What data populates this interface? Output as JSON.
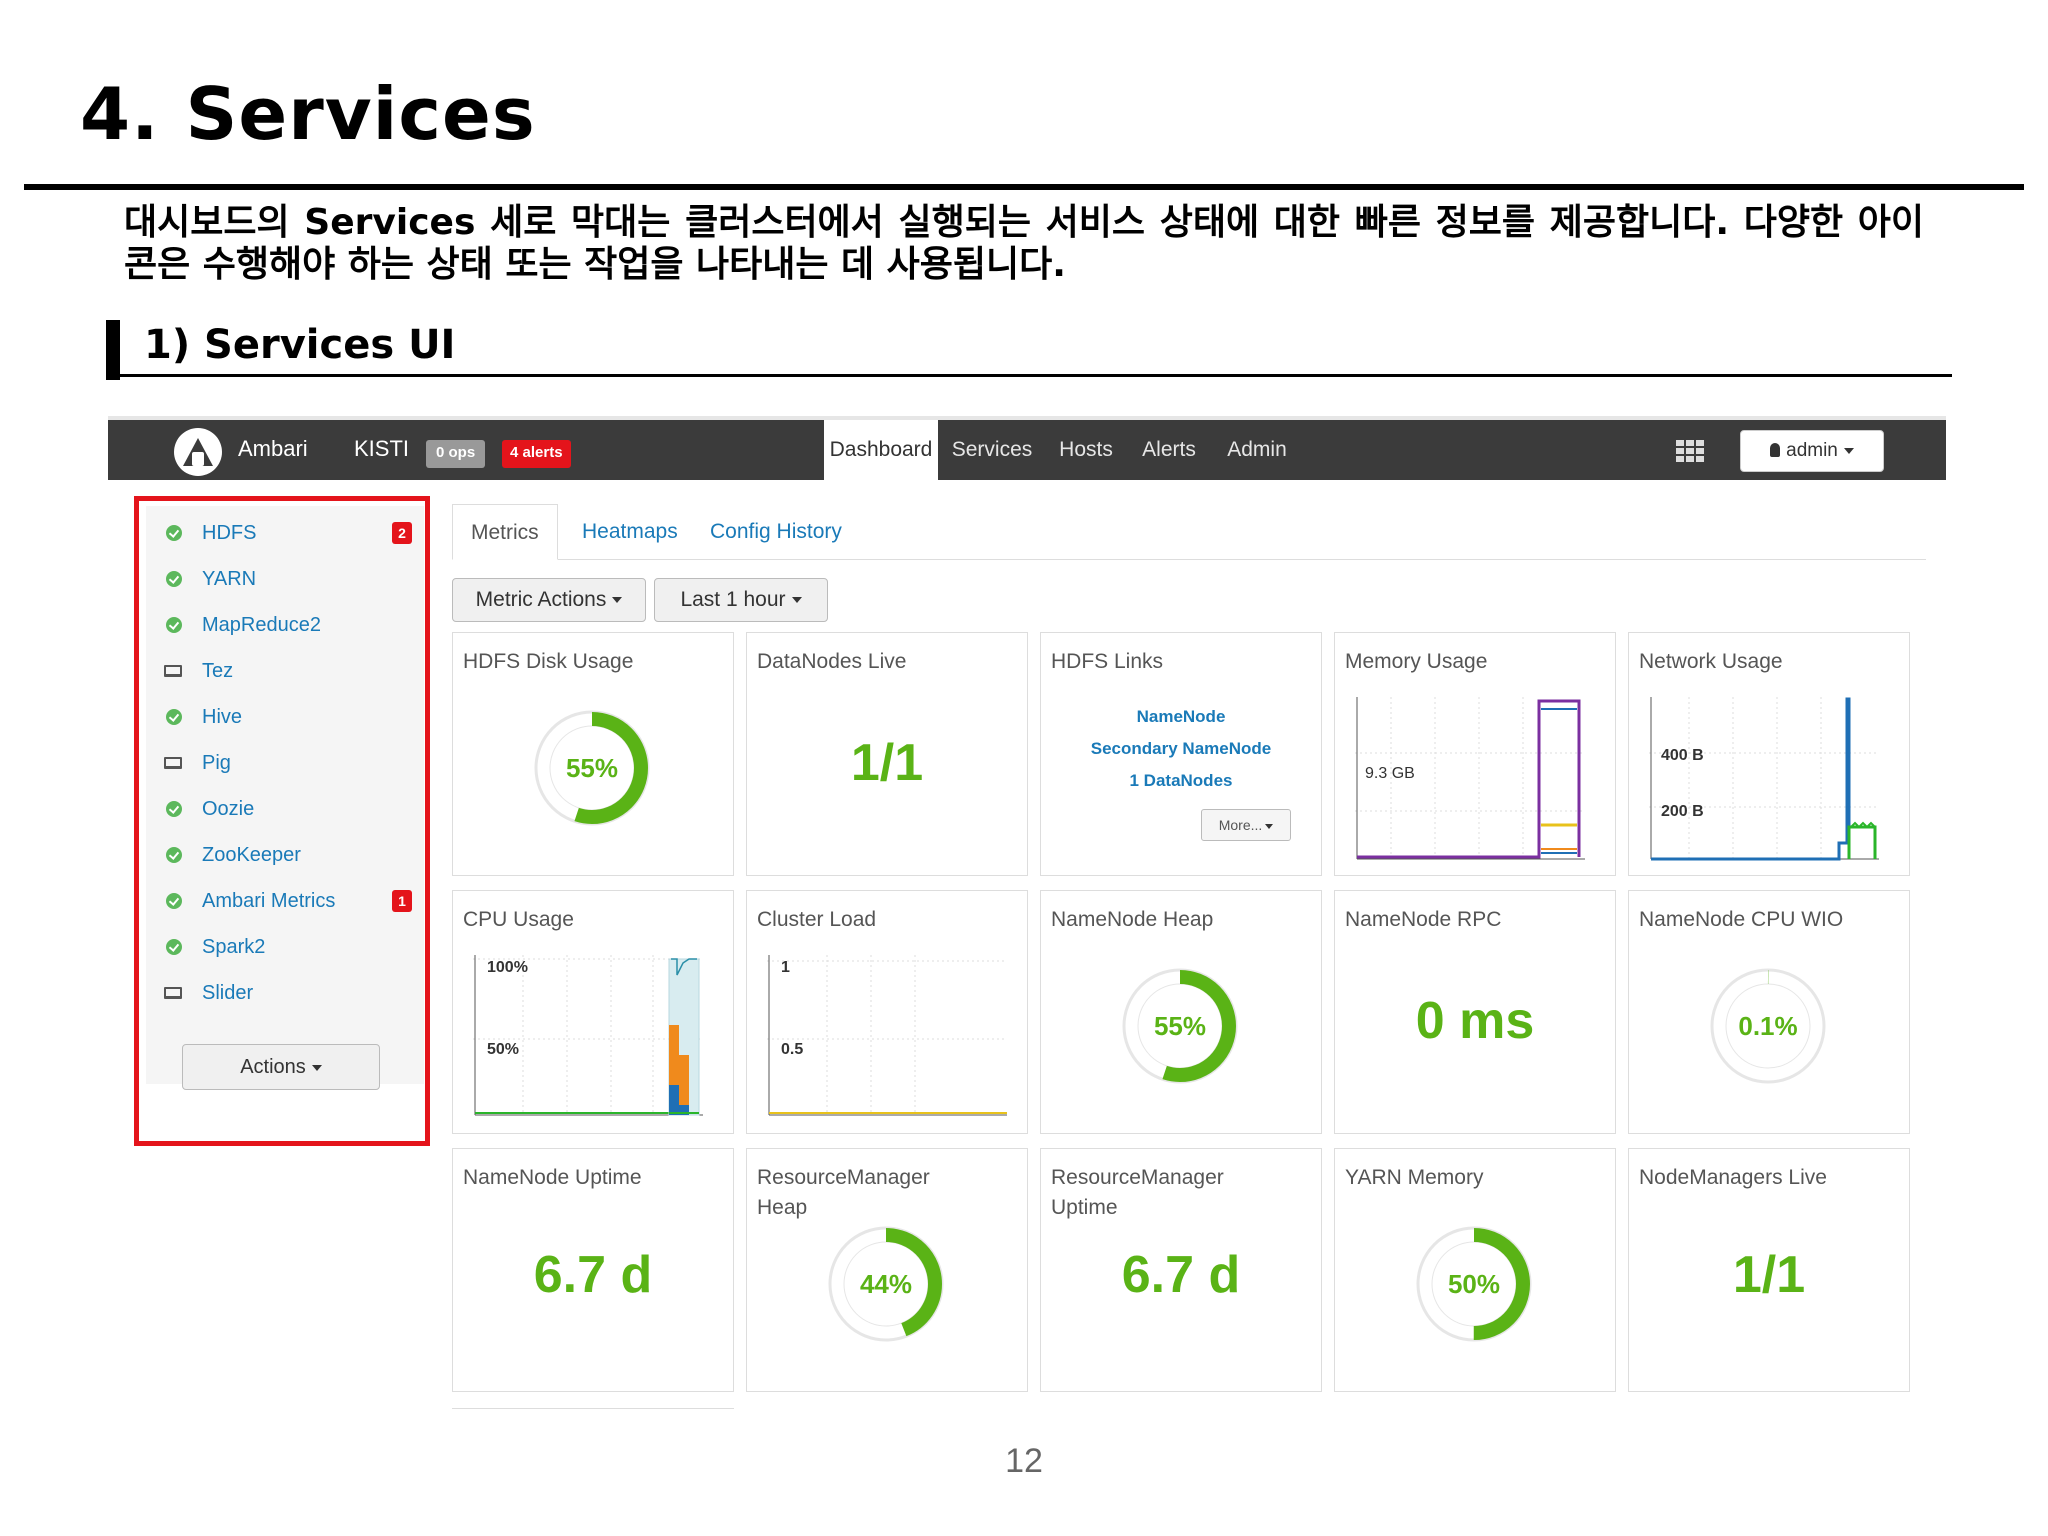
{
  "slide": {
    "title": "4. Services",
    "description": "대시보드의 Services 세로 막대는 클러스터에서 실행되는 서비스 상태에 대한 빠른 정보를 제공합니다. 다양한 아이콘은 수행해야 하는 상태 또는 작업을 나타내는 데 사용됩니다.",
    "section_title": "1) Services UI",
    "page_number": "12"
  },
  "topbar": {
    "brand": "Ambari",
    "cluster": "KISTI",
    "ops_badge": "0 ops",
    "alerts_badge": "4 alerts",
    "tabs": [
      "Dashboard",
      "Services",
      "Hosts",
      "Alerts",
      "Admin"
    ],
    "active_tab": "Dashboard",
    "user_label": "admin"
  },
  "sidebar": {
    "services": [
      {
        "name": "HDFS",
        "icon": "check-circle-icon",
        "badge": "2"
      },
      {
        "name": "YARN",
        "icon": "check-circle-icon",
        "badge": ""
      },
      {
        "name": "MapReduce2",
        "icon": "check-circle-icon",
        "badge": ""
      },
      {
        "name": "Tez",
        "icon": "laptop-icon",
        "badge": ""
      },
      {
        "name": "Hive",
        "icon": "check-circle-icon",
        "badge": ""
      },
      {
        "name": "Pig",
        "icon": "laptop-icon",
        "badge": ""
      },
      {
        "name": "Oozie",
        "icon": "check-circle-icon",
        "badge": ""
      },
      {
        "name": "ZooKeeper",
        "icon": "check-circle-icon",
        "badge": ""
      },
      {
        "name": "Ambari Metrics",
        "icon": "check-circle-icon",
        "badge": "1"
      },
      {
        "name": "Spark2",
        "icon": "check-circle-icon",
        "badge": ""
      },
      {
        "name": "Slider",
        "icon": "laptop-icon",
        "badge": ""
      }
    ],
    "actions_label": "Actions"
  },
  "content": {
    "tabs": [
      "Metrics",
      "Heatmaps",
      "Config History"
    ],
    "metric_actions_label": "Metric Actions",
    "time_range_label": "Last 1 hour"
  },
  "widgets": {
    "hdfs_disk_usage": {
      "title": "HDFS Disk Usage",
      "value": "55%",
      "fraction": 0.55
    },
    "datanodes_live": {
      "title": "DataNodes Live",
      "value": "1/1"
    },
    "hdfs_links": {
      "title": "HDFS Links",
      "links": [
        "NameNode",
        "Secondary NameNode",
        "1 DataNodes"
      ],
      "more_label": "More..."
    },
    "memory_usage": {
      "title": "Memory Usage",
      "axis_label": "9.3 GB"
    },
    "network_usage": {
      "title": "Network Usage",
      "axis_labels": [
        "400 B",
        "200 B"
      ]
    },
    "cpu_usage": {
      "title": "CPU Usage",
      "axis_labels": [
        "100%",
        "50%"
      ]
    },
    "cluster_load": {
      "title": "Cluster Load",
      "axis_labels": [
        "1",
        "0.5"
      ]
    },
    "namenode_heap": {
      "title": "NameNode Heap",
      "value": "55%",
      "fraction": 0.55
    },
    "namenode_rpc": {
      "title": "NameNode RPC",
      "value": "0 ms"
    },
    "namenode_cpu_wio": {
      "title": "NameNode CPU WIO",
      "value": "0.1%",
      "fraction": 0.001
    },
    "namenode_uptime": {
      "title": "NameNode Uptime",
      "value": "6.7 d"
    },
    "resourcemanager_heap": {
      "title_line1": "ResourceManager",
      "title_line2": "Heap",
      "value": "44%",
      "fraction": 0.44
    },
    "resourcemanager_uptime": {
      "title_line1": "ResourceManager",
      "title_line2": "Uptime",
      "value": "6.7 d"
    },
    "yarn_memory": {
      "title": "YARN Memory",
      "value": "50%",
      "fraction": 0.5
    },
    "nodemanagers_live": {
      "title": "NodeManagers Live",
      "value": "1/1"
    }
  },
  "colors": {
    "ok_green": "#5cb85c",
    "metric_green": "#5ab316",
    "link_blue": "#1a7ab8",
    "alert_red": "#e4141b",
    "topbar_dark": "#3b3b3b"
  }
}
